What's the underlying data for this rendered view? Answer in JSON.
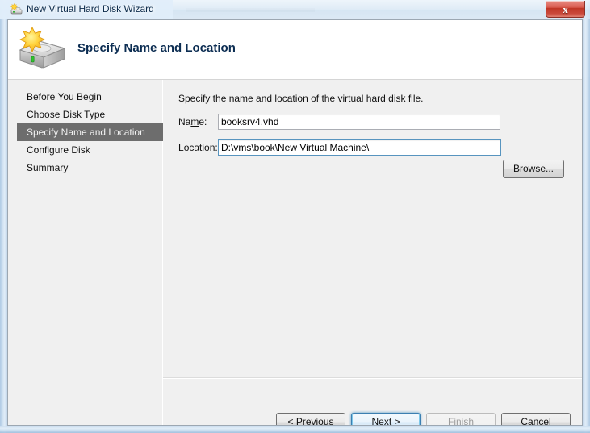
{
  "window": {
    "title": "New Virtual Hard Disk Wizard",
    "icon": "vhd-wizard-icon",
    "close_label": "x"
  },
  "banner": {
    "title": "Specify Name and Location",
    "icon": "new-hard-disk-icon"
  },
  "sidebar": {
    "items": [
      {
        "label": "Before You Begin",
        "selected": false
      },
      {
        "label": "Choose Disk Type",
        "selected": false
      },
      {
        "label": "Specify Name and Location",
        "selected": true
      },
      {
        "label": "Configure Disk",
        "selected": false
      },
      {
        "label": "Summary",
        "selected": false
      }
    ]
  },
  "content": {
    "intro": "Specify the name and location of the virtual hard disk file.",
    "fields": [
      {
        "label": "Name:",
        "accel_before": "Na",
        "accel_char": "m",
        "accel_after": "e:",
        "value": "booksrv4.vhd"
      },
      {
        "label": "Location:",
        "accel_before": "L",
        "accel_char": "o",
        "accel_after": "cation:",
        "value": "D:\\vms\\book\\New Virtual Machine\\"
      }
    ],
    "browse": {
      "accel_char": "B",
      "accel_after": "rowse..."
    }
  },
  "buttons": [
    {
      "name": "previous",
      "prefix": "< ",
      "accel_char": "P",
      "suffix": "revious",
      "state": "normal"
    },
    {
      "name": "next",
      "prefix": "",
      "accel_char": "N",
      "suffix": "ext >",
      "state": "default"
    },
    {
      "name": "finish",
      "prefix": "",
      "accel_char": "F",
      "suffix": "inish",
      "state": "disabled"
    },
    {
      "name": "cancel",
      "prefix": "",
      "accel_char": "",
      "suffix": "Cancel",
      "state": "normal"
    }
  ],
  "colors": {
    "selected_item_bg": "#6d6d6d",
    "banner_title": "#0c2d52",
    "default_button_border": "#3c7fb1",
    "focused_input_border": "#5794bf",
    "close_button": "#bf3626"
  }
}
